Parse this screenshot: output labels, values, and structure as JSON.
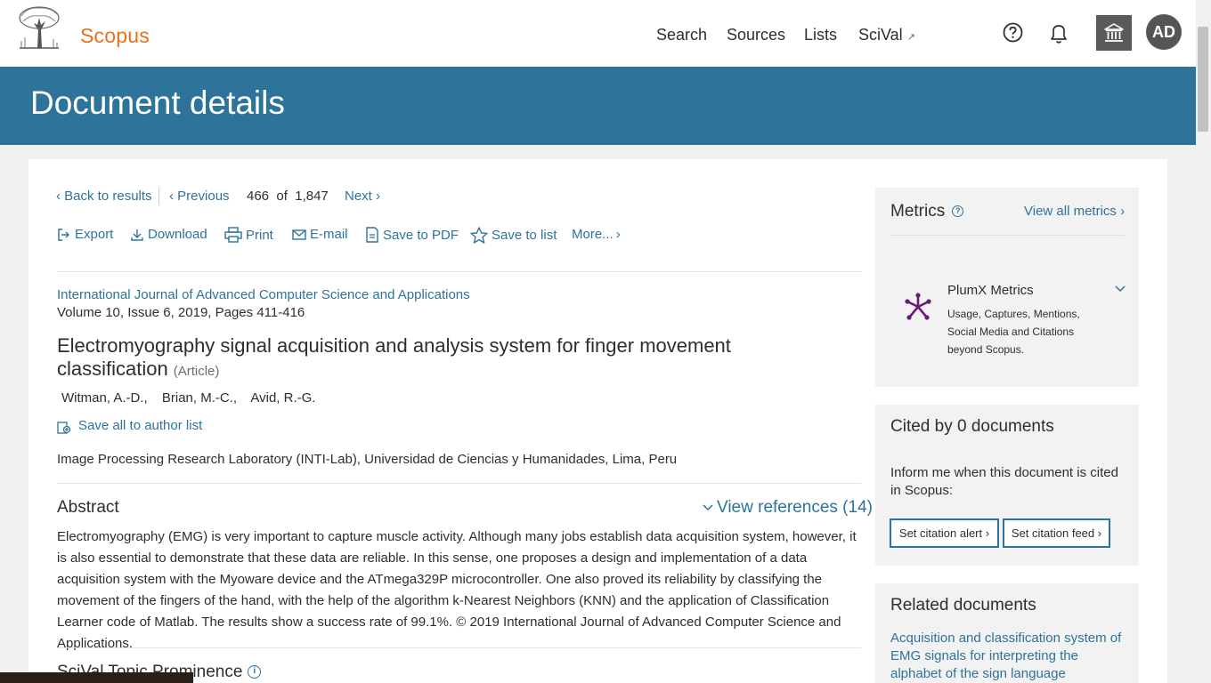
{
  "brand": {
    "name": "Scopus"
  },
  "topnav": {
    "search": "Search",
    "sources": "Sources",
    "lists": "Lists",
    "scival": "SciVal",
    "scival_external_icon": "↗",
    "avatar_initials": "AD"
  },
  "header": {
    "title": "Document details"
  },
  "results_nav": {
    "back": "Back to results",
    "previous": "Previous",
    "position": "466",
    "of": "of",
    "total": "1,847",
    "next": "Next"
  },
  "toolbar": {
    "export": "Export",
    "download": "Download",
    "print": "Print",
    "email": "E-mail",
    "save_pdf": "Save to PDF",
    "save_list": "Save to list",
    "more": "More..."
  },
  "document": {
    "journal": "International Journal of Advanced Computer Science and Applications",
    "volume": "Volume 10, Issue 6, 2019, Pages 411-416",
    "title": "Electromyography signal acquisition and analysis system for finger movement classification",
    "type": "(Article)",
    "authors": [
      "Witman, A.-D.,",
      "Brian, M.-C.,",
      "Avid, R.-G."
    ],
    "save_authors": "Save all to author list",
    "affiliation": "Image Processing Research Laboratory (INTI-Lab), Universidad de Ciencias y Humanidades, Lima, Peru"
  },
  "abstract": {
    "heading": "Abstract",
    "view_references": "View references (14)",
    "text": "Electromyography (EMG) is very important to capture muscle activity. Although many jobs establish data acquisition system, however, it is also essential to demonstrate that these data are reliable. In this sense, one proposes a design and implementation of a data acquisition system with the Myoware device and the ATmega329P microcontroller. One also proved its reliability by classifying the movement of the fingers of the hand, with the help of the algorithm k-Nearest Neighbors (KNN) and the application of Classification Learner code of Matlab. The results show a success rate of 99.1%. © 2019 International Journal of Advanced Computer Science and Applications."
  },
  "topic": {
    "heading": "SciVal Topic Prominence"
  },
  "metrics": {
    "heading": "Metrics",
    "view_all": "View all metrics",
    "plumx_title": "PlumX Metrics",
    "plumx_desc": "Usage, Captures, Mentions, Social Media and Citations beyond Scopus."
  },
  "cited": {
    "heading": "Cited by 0 documents",
    "text": "Inform me when this document is cited in Scopus:",
    "alert_btn": "Set citation alert",
    "feed_btn": "Set citation feed"
  },
  "related": {
    "heading": "Related documents",
    "first": "Acquisition and classification system of EMG signals for interpreting the alphabet of the sign language"
  },
  "colors": {
    "accent": "#2e7399",
    "brand": "#e9711c",
    "plumx": "#6a1b7a"
  }
}
